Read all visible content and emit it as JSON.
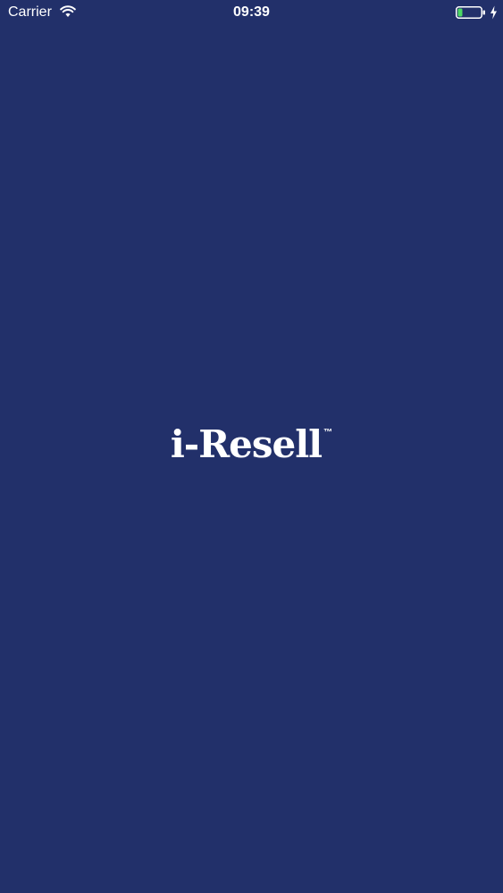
{
  "status_bar": {
    "carrier": "Carrier",
    "time": "09:39",
    "icons": [
      "wifi-icon",
      "battery-icon",
      "charging-icon"
    ],
    "battery_level": 0.2
  },
  "splash": {
    "logo_text": "i-Resell",
    "trademark": "™"
  },
  "colors": {
    "background": "#22306a",
    "foreground": "#ffffff",
    "battery_fill": "#4cd964"
  }
}
